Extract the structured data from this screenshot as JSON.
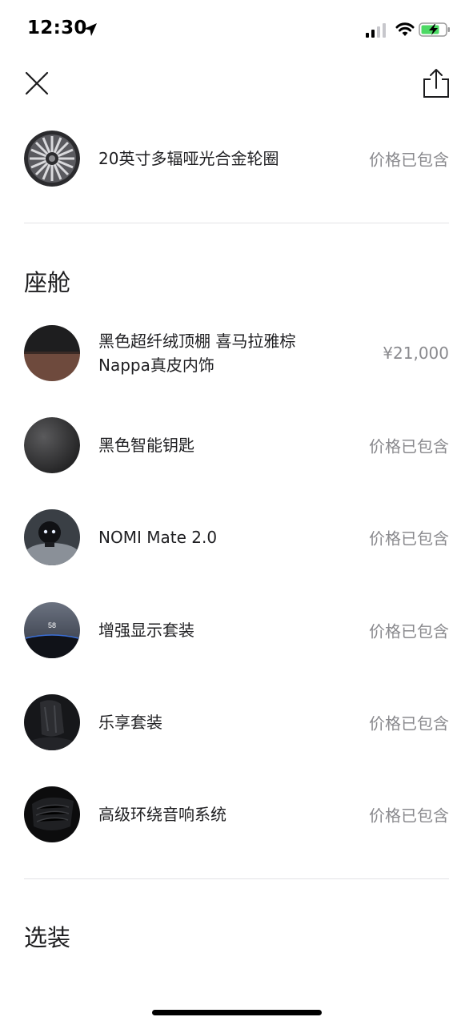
{
  "status_bar": {
    "time": "12:30"
  },
  "wheel": {
    "label": "20英寸多辐哑光合金轮圈",
    "price": "价格已包含"
  },
  "cabin": {
    "title": "座舱",
    "items": [
      {
        "label": "黑色超纤绒顶棚 喜马拉雅棕Nappa真皮内饰",
        "price": "¥21,000"
      },
      {
        "label": "黑色智能钥匙",
        "price": "价格已包含"
      },
      {
        "label": "NOMI Mate 2.0",
        "price": "价格已包含"
      },
      {
        "label": "增强显示套装",
        "price": "价格已包含",
        "hud_value": "58"
      },
      {
        "label": "乐享套装",
        "price": "价格已包含"
      },
      {
        "label": "高级环绕音响系统",
        "price": "价格已包含"
      }
    ]
  },
  "options": {
    "title": "选装"
  },
  "icons": {
    "close": "close-icon",
    "share": "share-icon",
    "location": "location-arrow-icon",
    "signal": "signal-icon",
    "wifi": "wifi-icon",
    "battery": "battery-charging-icon"
  },
  "colors": {
    "text": "#1c1c1e",
    "muted": "#8a8a8e",
    "divider": "#e3e3e6",
    "battery": "#4cd964"
  }
}
